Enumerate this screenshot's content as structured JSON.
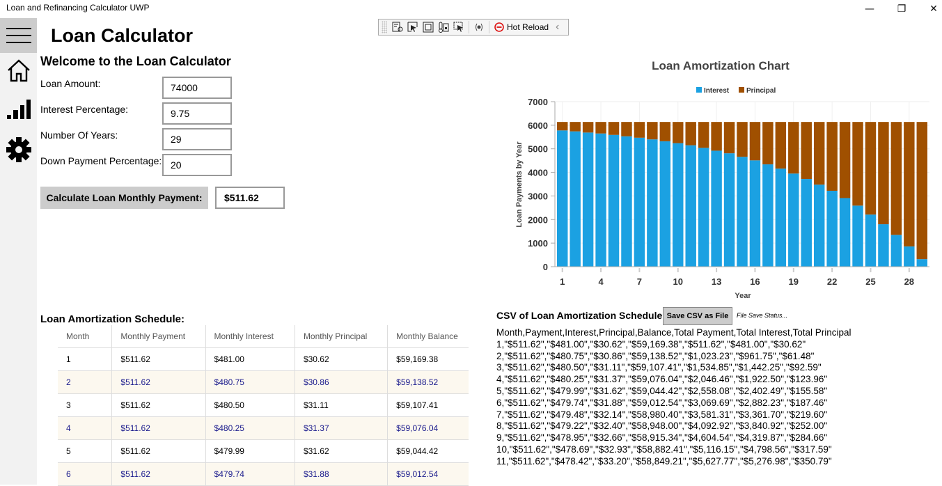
{
  "window": {
    "title": "Loan and Refinancing Calculator UWP",
    "minimize_glyph": "—",
    "restore_glyph": "❐",
    "close_glyph": "✕"
  },
  "sidebar": {
    "items": [
      {
        "icon": "hamburger-menu-icon"
      },
      {
        "icon": "home-icon"
      },
      {
        "icon": "signal-bars-icon"
      },
      {
        "icon": "gear-icon"
      }
    ]
  },
  "toolbar": {
    "hot_reload_label": "Hot Reload",
    "collapse_glyph": "‹"
  },
  "page": {
    "title": "Loan Calculator",
    "welcome": "Welcome to the Loan Calculator"
  },
  "form": {
    "loan_amount_label": "Loan Amount:",
    "loan_amount_value": "74000",
    "interest_label": "Interest Percentage:",
    "interest_value": "9.75",
    "years_label": "Number Of Years:",
    "years_value": "29",
    "down_payment_label": "Down Payment Percentage:",
    "down_payment_value": "20",
    "calculate_label": "Calculate Loan Monthly Payment:",
    "monthly_payment_result": "$511.62"
  },
  "schedule": {
    "title": "Loan Amortization Schedule:",
    "columns": [
      "Month",
      "Monthly Payment",
      "Monthly Interest",
      "Monthly Principal",
      "Monthly Balance"
    ],
    "rows": [
      [
        "1",
        "$511.62",
        "$481.00",
        "$30.62",
        "$59,169.38"
      ],
      [
        "2",
        "$511.62",
        "$480.75",
        "$30.86",
        "$59,138.52"
      ],
      [
        "3",
        "$511.62",
        "$480.50",
        "$31.11",
        "$59,107.41"
      ],
      [
        "4",
        "$511.62",
        "$480.25",
        "$31.37",
        "$59,076.04"
      ],
      [
        "5",
        "$511.62",
        "$479.99",
        "$31.62",
        "$59,044.42"
      ],
      [
        "6",
        "$511.62",
        "$479.74",
        "$31.88",
        "$59,012.54"
      ]
    ]
  },
  "csv": {
    "title": "CSV of Loan Amortization Schedule",
    "save_label": "Save CSV as File",
    "status": "File Save Status...",
    "lines": [
      "Month,Payment,Interest,Principal,Balance,Total Payment,Total Interest,Total Principal",
      "1,\"$511.62\",\"$481.00\",\"$30.62\",\"$59,169.38\",\"$511.62\",\"$481.00\",\"$30.62\"",
      "2,\"$511.62\",\"$480.75\",\"$30.86\",\"$59,138.52\",\"$1,023.23\",\"$961.75\",\"$61.48\"",
      "3,\"$511.62\",\"$480.50\",\"$31.11\",\"$59,107.41\",\"$1,534.85\",\"$1,442.25\",\"$92.59\"",
      "4,\"$511.62\",\"$480.25\",\"$31.37\",\"$59,076.04\",\"$2,046.46\",\"$1,922.50\",\"$123.96\"",
      "5,\"$511.62\",\"$479.99\",\"$31.62\",\"$59,044.42\",\"$2,558.08\",\"$2,402.49\",\"$155.58\"",
      "6,\"$511.62\",\"$479.74\",\"$31.88\",\"$59,012.54\",\"$3,069.69\",\"$2,882.23\",\"$187.46\"",
      "7,\"$511.62\",\"$479.48\",\"$32.14\",\"$58,980.40\",\"$3,581.31\",\"$3,361.70\",\"$219.60\"",
      "8,\"$511.62\",\"$479.22\",\"$32.40\",\"$58,948.00\",\"$4,092.92\",\"$3,840.92\",\"$252.00\"",
      "9,\"$511.62\",\"$478.95\",\"$32.66\",\"$58,915.34\",\"$4,604.54\",\"$4,319.87\",\"$284.66\"",
      "10,\"$511.62\",\"$478.69\",\"$32.93\",\"$58,882.41\",\"$5,116.15\",\"$4,798.56\",\"$317.59\"",
      "11,\"$511.62\",\"$478.42\",\"$33.20\",\"$58,849.21\",\"$5,627.77\",\"$5,276.98\",\"$350.79\""
    ]
  },
  "chart_data": {
    "type": "bar",
    "stacked": true,
    "title": "Loan Amortization Chart",
    "xlabel": "Year",
    "ylabel": "Loan Payments by Year",
    "ylim": [
      0,
      7000
    ],
    "yticks": [
      0,
      1000,
      2000,
      3000,
      4000,
      5000,
      6000,
      7000
    ],
    "xtick_labels": [
      "1",
      "4",
      "7",
      "10",
      "13",
      "16",
      "19",
      "22",
      "25",
      "28"
    ],
    "legend_position": "top-center",
    "grid": true,
    "categories": [
      1,
      2,
      3,
      4,
      5,
      6,
      7,
      8,
      9,
      10,
      11,
      12,
      13,
      14,
      15,
      16,
      17,
      18,
      19,
      20,
      21,
      22,
      23,
      24,
      25,
      26,
      27,
      28,
      29
    ],
    "series": [
      {
        "name": "Interest",
        "color": "#1ba1e2",
        "values": [
          5780,
          5740,
          5690,
          5650,
          5590,
          5530,
          5470,
          5400,
          5320,
          5240,
          5150,
          5040,
          4920,
          4810,
          4660,
          4510,
          4340,
          4160,
          3950,
          3720,
          3480,
          3220,
          2910,
          2590,
          2210,
          1800,
          1350,
          860,
          320
        ]
      },
      {
        "name": "Principal",
        "color": "#a05000",
        "values": [
          359,
          399,
          449,
          489,
          549,
          609,
          669,
          739,
          819,
          899,
          989,
          1099,
          1219,
          1329,
          1479,
          1629,
          1799,
          1979,
          2189,
          2419,
          2659,
          2919,
          3229,
          3549,
          3929,
          4339,
          4789,
          5279,
          5819
        ]
      }
    ]
  }
}
